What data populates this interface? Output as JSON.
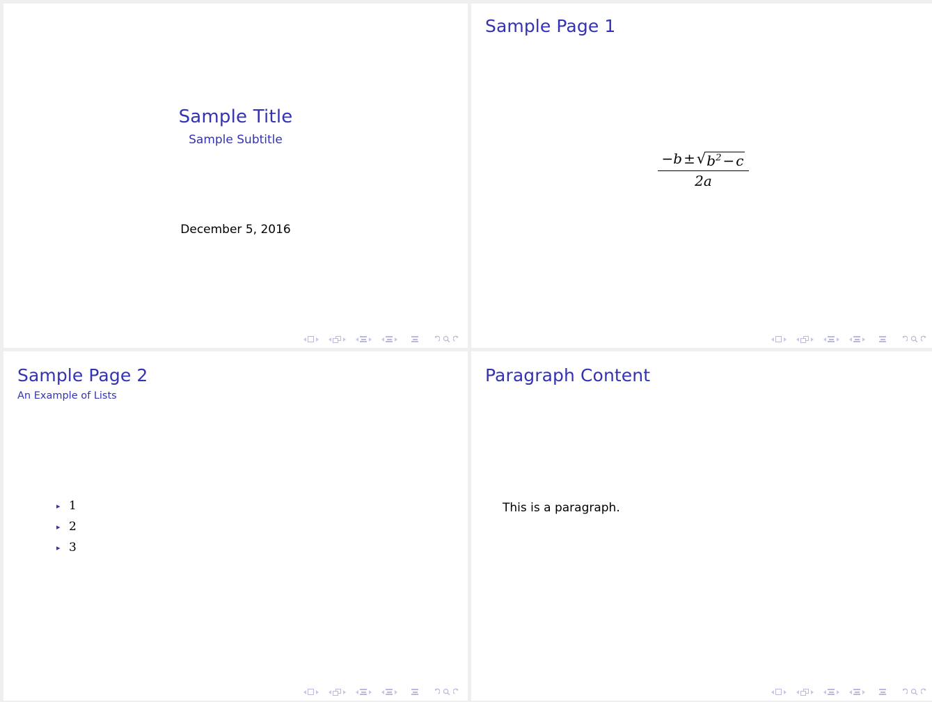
{
  "theme": {
    "structure_color": "#3333b3",
    "text_color": "#000000",
    "page_background": "#ffffff",
    "gutter_color": "#efefef",
    "nav_icon_color": "#b9b9dd"
  },
  "slides": [
    {
      "kind": "title-slide",
      "title": "Sample Title",
      "subtitle": "Sample Subtitle",
      "date": "December 5, 2016"
    },
    {
      "kind": "formula-slide",
      "frametitle": "Sample Page 1",
      "formula": {
        "numerator": "−b ± √(b² − c)",
        "denominator": "2a",
        "minus_b": "−b",
        "plus_minus": "±",
        "radical_sign": "√",
        "radicand_base": "b",
        "radicand_exponent": "2",
        "radicand_op": "−",
        "radicand_tail": "c",
        "den_coefficient": "2",
        "den_variable": "a"
      }
    },
    {
      "kind": "list-slide",
      "frametitle": "Sample Page 2",
      "framesubtitle": "An Example of Lists",
      "bullet_glyph": "▸",
      "items": [
        "1",
        "2",
        "3"
      ]
    },
    {
      "kind": "paragraph-slide",
      "frametitle": "Paragraph Content",
      "body": "This is a paragraph."
    }
  ],
  "navigation": {
    "groups": [
      {
        "name": "frame-navigation",
        "icon": "square-icon",
        "prev": "◂",
        "next": "▸"
      },
      {
        "name": "slide-navigation",
        "icon": "stacked-pages-icon",
        "prev": "◂",
        "next": "▸"
      },
      {
        "name": "subsection-navigation",
        "icon": "bars-icon",
        "prev": "◂",
        "next": "▸"
      },
      {
        "name": "section-navigation",
        "icon": "bars-icon",
        "prev": "◂",
        "next": "▸"
      }
    ],
    "presentation_icon": "bars-icon",
    "back_icon": "↺",
    "search_icon": "⚲",
    "forward_icon": "↻"
  }
}
